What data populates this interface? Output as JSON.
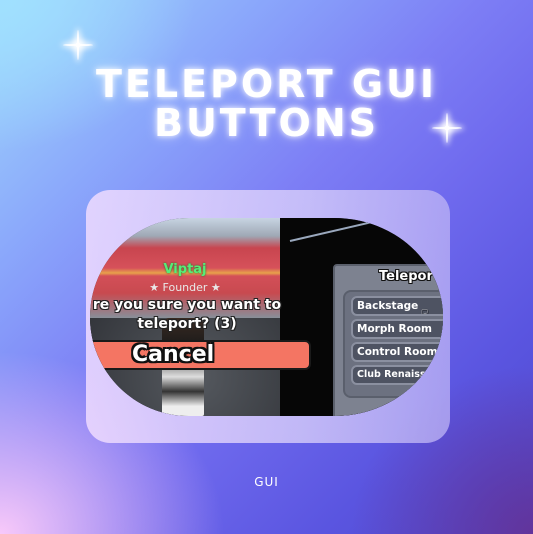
{
  "title": {
    "line1": "TELEPORT GUI",
    "line2": "BUTTONS"
  },
  "caption": "GUI",
  "decor": {
    "sparkle_icon": "four-point-star",
    "accent_colors": {
      "background_start": "#9fd8fb",
      "background_mid": "#7d7ef5",
      "background_end": "#4e47cc",
      "cancel_button": "#f47563",
      "player_name": "#55ee77"
    }
  },
  "game_screenshot": {
    "player": {
      "name": "Viptaj",
      "rank": "★ Founder ★"
    },
    "prompt": "re you sure you want to teleport? (3)",
    "prompt_lines": [
      "re you sure you want to",
      "teleport? (3)"
    ],
    "cancel_label": "Cancel",
    "teleport_panel": {
      "title": "Telepor",
      "items": [
        {
          "label": "Backstage"
        },
        {
          "label": "Morph Room"
        },
        {
          "label": "Control Room"
        },
        {
          "label": "Club Renaissan"
        }
      ],
      "cursor_icon": "hand-pointer"
    }
  }
}
